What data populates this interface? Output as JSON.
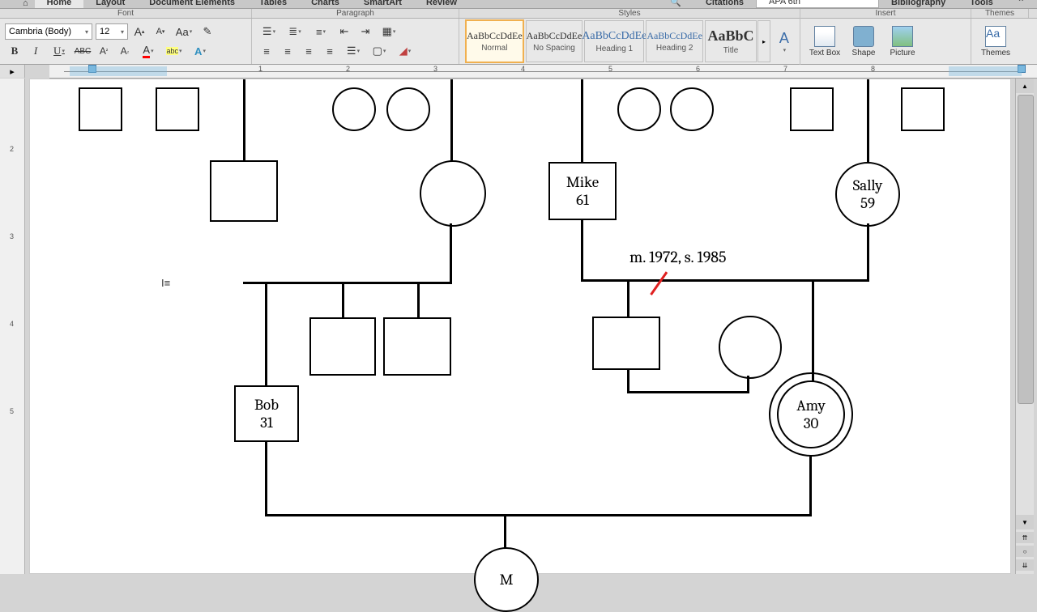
{
  "tabs": {
    "home": "Home",
    "layout": "Layout",
    "doc_elements": "Document Elements",
    "tables": "Tables",
    "charts": "Charts",
    "smartart": "SmartArt",
    "review": "Review",
    "citations": "Citations",
    "bib": "Bibliography",
    "tools": "Tools",
    "citation_style": "APA 6th"
  },
  "ribbon_labels": {
    "font": "Font",
    "paragraph": "Paragraph",
    "styles": "Styles",
    "insert": "Insert",
    "themes": "Themes"
  },
  "font": {
    "name": "Cambria (Body)",
    "size": "12"
  },
  "font_btns": {
    "bold": "B",
    "italic": "I",
    "underline": "U",
    "strike": "ABC",
    "grow": "A",
    "shrink": "A",
    "case": "Aa",
    "clear": "Ab",
    "super": "A",
    "sub": "A",
    "fontcolor": "A",
    "highlight": "abc",
    "effects": "A"
  },
  "styles": {
    "sample": "AaBbCcDdEe",
    "sample_big": "AaBbC",
    "normal": "Normal",
    "nospacing": "No Spacing",
    "heading1": "Heading 1",
    "heading2": "Heading 2",
    "title": "Title"
  },
  "insert": {
    "textbox": "Text Box",
    "shape": "Shape",
    "picture": "Picture",
    "themes": "Themes"
  },
  "ruler_marks": [
    "1",
    "2",
    "3",
    "4",
    "5",
    "6",
    "7",
    "8"
  ],
  "vruler_marks": [
    "2",
    "3",
    "4",
    "5"
  ],
  "genogram": {
    "mike_name": "Mike",
    "mike_age": "61",
    "sally_name": "Sally",
    "sally_age": "59",
    "bob_name": "Bob",
    "bob_age": "31",
    "amy_name": "Amy",
    "amy_age": "30",
    "m_name": "M",
    "marriage": "m. 1972, s. 1985"
  }
}
